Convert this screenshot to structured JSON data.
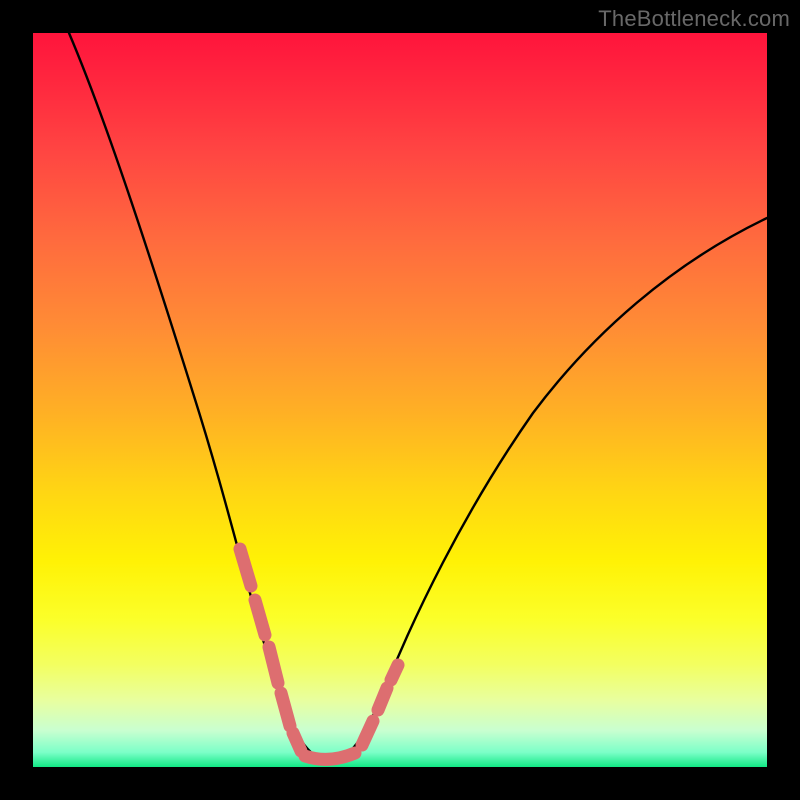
{
  "watermark": "TheBottleneck.com",
  "colors": {
    "page_bg": "#000000",
    "curve_main": "#000000",
    "curve_highlight": "#dd6e70"
  },
  "chart_data": {
    "type": "line",
    "title": "",
    "xlabel": "",
    "ylabel": "",
    "xlim": [
      0,
      100
    ],
    "ylim": [
      0,
      100
    ],
    "grid": false,
    "legend": false,
    "background": "rainbow-vertical",
    "series": [
      {
        "name": "bottleneck-curve",
        "x": [
          5,
          8,
          12,
          16,
          20,
          24,
          27,
          29,
          31,
          33,
          35,
          37,
          40,
          43,
          47,
          52,
          58,
          65,
          72,
          80,
          88,
          96,
          100
        ],
        "y": [
          100,
          91,
          81,
          70,
          59,
          47,
          36,
          27,
          18,
          10,
          5,
          2,
          1,
          2,
          6,
          13,
          22,
          32,
          41,
          49,
          56,
          62,
          65
        ]
      }
    ],
    "annotations": [
      {
        "name": "highlight-segments",
        "style": "thick-pink-dashed",
        "segments": [
          {
            "x": [
              27.0,
              29.5,
              31.5,
              33.0,
              34.5
            ],
            "y": [
              33,
              22,
              13,
              7,
              3
            ]
          },
          {
            "x": [
              35.5,
              38.0,
              40.5,
              43.0
            ],
            "y": [
              1.2,
              0.8,
              0.9,
              1.5
            ]
          },
          {
            "x": [
              44.5,
              46.0,
              47.0,
              48.0
            ],
            "y": [
              3.5,
              6.5,
              9.5,
              12.0
            ]
          }
        ]
      }
    ]
  }
}
